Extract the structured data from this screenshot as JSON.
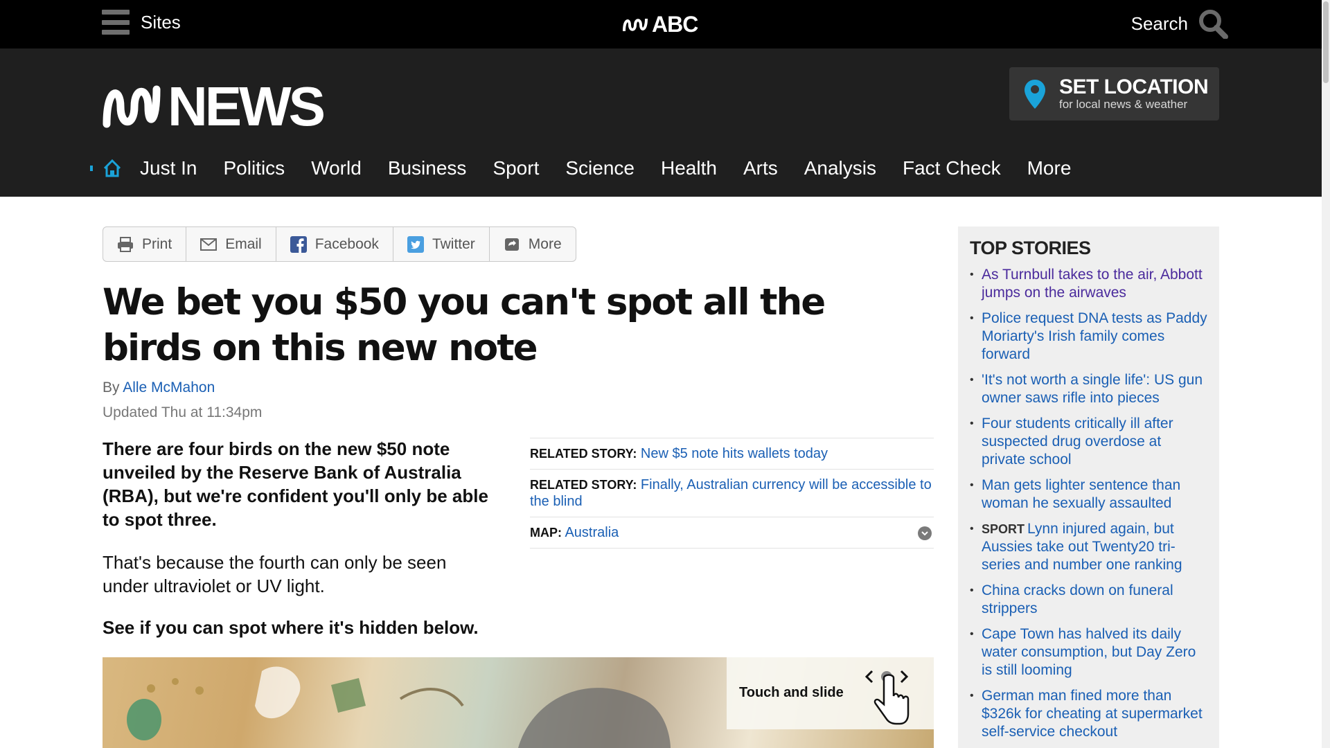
{
  "topbar": {
    "sites_label": "Sites",
    "brand": "ABC",
    "search_label": "Search"
  },
  "header": {
    "logo_text": "NEWS",
    "set_location": {
      "title": "SET LOCATION",
      "subtitle": "for local news & weather"
    },
    "nav": [
      "Just In",
      "Politics",
      "World",
      "Business",
      "Sport",
      "Science",
      "Health",
      "Arts",
      "Analysis",
      "Fact Check",
      "More"
    ]
  },
  "share": {
    "print": "Print",
    "email": "Email",
    "facebook": "Facebook",
    "twitter": "Twitter",
    "more": "More"
  },
  "article": {
    "headline": "We bet you $50 you can't spot all the birds on this new note",
    "by_prefix": "By",
    "author": "Alle McMahon",
    "updated": "Updated Thu at 11:34pm",
    "lead": "There are four birds on the new $50 note unveiled by the Reserve Bank of Australia (RBA), but we're confident you'll only be able to spot three.",
    "paragraph1": "That's because the fourth can only be seen under ultraviolet or UV light.",
    "paragraph2": "See if you can spot where it's hidden below.",
    "related": [
      {
        "label": "RELATED STORY:",
        "link": "New $5 note hits wallets today"
      },
      {
        "label": "RELATED STORY:",
        "link": "Finally, Australian currency will be accessible to the blind"
      },
      {
        "label": "MAP:",
        "link": "Australia"
      }
    ],
    "slider_hint": "Touch and slide"
  },
  "sidebar": {
    "title": "TOP STORIES",
    "stories": [
      {
        "tag": "",
        "text": "As Turnbull takes to the air, Abbott jumps on the airwaves",
        "visited": true
      },
      {
        "tag": "",
        "text": "Police request DNA tests as Paddy Moriarty's Irish family comes forward",
        "visited": false
      },
      {
        "tag": "",
        "text": "'It's not worth a single life': US gun owner saws rifle into pieces",
        "visited": false
      },
      {
        "tag": "",
        "text": "Four students critically ill after suspected drug overdose at private school",
        "visited": false
      },
      {
        "tag": "",
        "text": "Man gets lighter sentence than woman he sexually assaulted",
        "visited": false
      },
      {
        "tag": "SPORT",
        "text": "Lynn injured again, but Aussies take out Twenty20 tri-series and number one ranking",
        "visited": false
      },
      {
        "tag": "",
        "text": "China cracks down on funeral strippers",
        "visited": false
      },
      {
        "tag": "",
        "text": "Cape Town has halved its daily water consumption, but Day Zero is still looming",
        "visited": false
      },
      {
        "tag": "",
        "text": "German man fined more than $326k for cheating at supermarket self-service checkout",
        "visited": false
      }
    ]
  },
  "colors": {
    "accent": "#1a5fb4",
    "nav_bg": "#1f1f1f",
    "pin": "#1aa3d9"
  }
}
